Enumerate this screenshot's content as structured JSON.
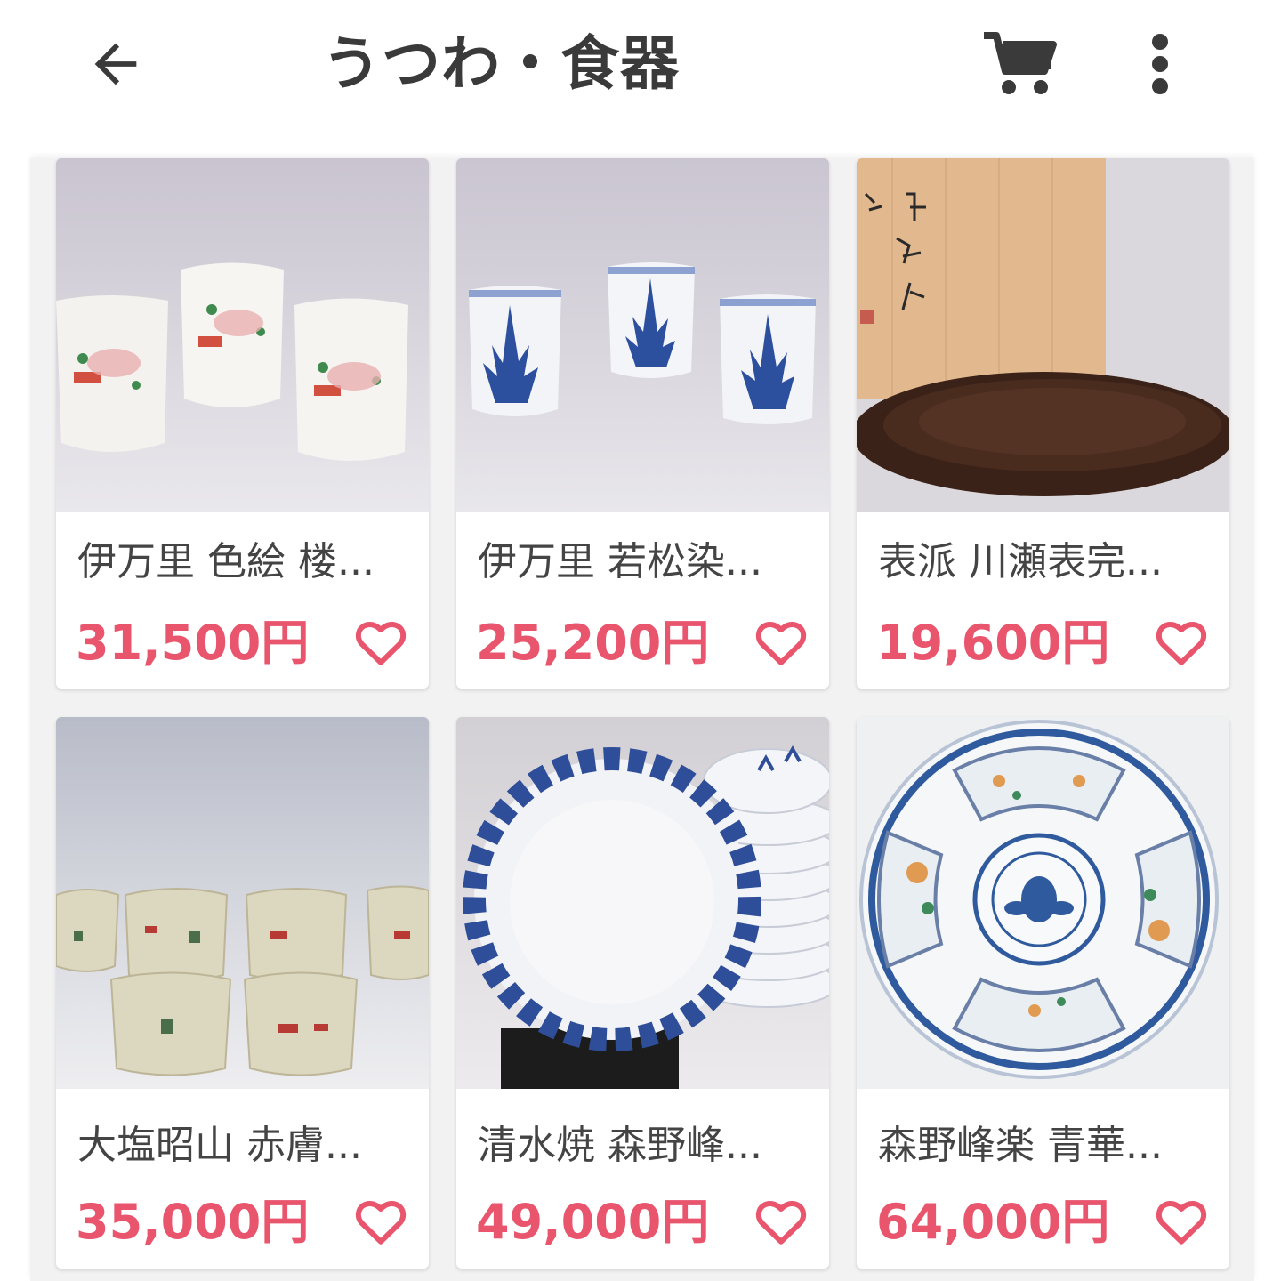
{
  "header": {
    "title": "うつわ・食器",
    "back_icon": "arrow-left-icon",
    "cart_icon": "cart-icon",
    "more_icon": "more-vertical-icon"
  },
  "colors": {
    "price": "#e8556d",
    "heart": "#e8556d",
    "title": "#3a3a3a",
    "icon": "#3a3a3a"
  },
  "products": [
    {
      "name": "伊万里 色絵 楼...",
      "price": "31,500円"
    },
    {
      "name": "伊万里 若松染...",
      "price": "25,200円"
    },
    {
      "name": "表派 川瀬表完...",
      "price": "19,600円"
    },
    {
      "name": "大塩昭山 赤膚...",
      "price": "35,000円"
    },
    {
      "name": "清水焼 森野峰...",
      "price": "49,000円"
    },
    {
      "name": "森野峰楽 青華...",
      "price": "64,000円"
    }
  ]
}
